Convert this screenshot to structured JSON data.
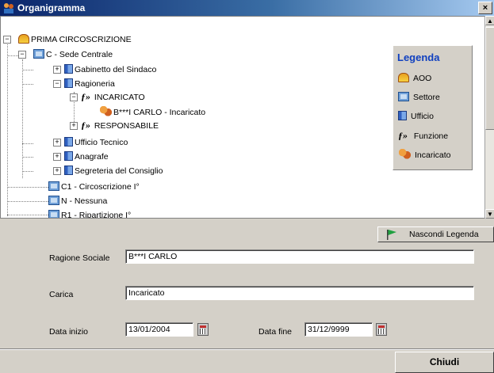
{
  "window": {
    "title": "Organigramma",
    "close_glyph": "×"
  },
  "tree": {
    "root": "PRIMA CIRCOSCRIZIONE",
    "sede": "C - Sede Centrale",
    "gabinetto": "Gabinetto del Sindaco",
    "ragioneria": "Ragioneria",
    "incaricato_fn": "INCARICATO",
    "incaricato_person": "B***I CARLO - Incaricato",
    "responsabile_fn": "RESPONSABILE",
    "ufficio_tecnico": "Ufficio Tecnico",
    "anagrafe": "Anagrafe",
    "segreteria": "Segreteria del Consiglio",
    "c1": "C1 - Circoscrizione I°",
    "n": "N - Nessuna",
    "r1": "R1 - Ripartizione I°",
    "expand_plus": "+",
    "expand_minus": "−"
  },
  "legend": {
    "title": "Legenda",
    "items": [
      {
        "label": "AOO",
        "icon": "aoo-icon"
      },
      {
        "label": "Settore",
        "icon": "settore-icon"
      },
      {
        "label": "Ufficio",
        "icon": "ufficio-icon"
      },
      {
        "label": "Funzione",
        "icon": "funzione-icon"
      },
      {
        "label": "Incaricato",
        "icon": "incaricato-icon"
      }
    ],
    "funzione_glyph": "ƒ»"
  },
  "form": {
    "toggle_legend_label": "Nascondi Legenda",
    "ragione_sociale_label": "Ragione Sociale",
    "ragione_sociale_value": "B***I CARLO",
    "carica_label": "Carica",
    "carica_value": "Incaricato",
    "data_inizio_label": "Data inizio",
    "data_inizio_value": "13/01/2004",
    "data_fine_label": "Data fine",
    "data_fine_value": "31/12/9999"
  },
  "footer": {
    "close_label": "Chiudi"
  },
  "colors": {
    "title_start": "#0a246a",
    "legend_title": "#1040c0",
    "face": "#d4d0c8"
  }
}
